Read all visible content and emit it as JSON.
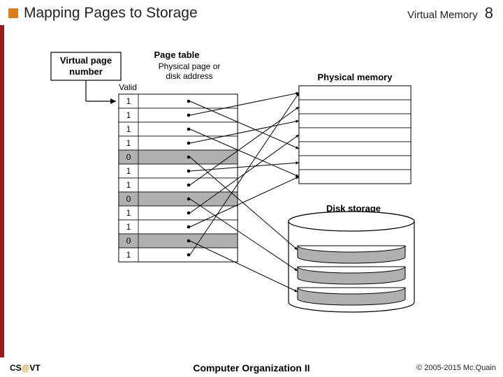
{
  "header": {
    "title": "Mapping Pages to Storage",
    "section": "Virtual Memory",
    "page_num": "8"
  },
  "diagram": {
    "vpn_box": [
      "Virtual page",
      "number"
    ],
    "pagetable_title": "Page table",
    "pagetable_sub": [
      "Physical page or",
      "disk address"
    ],
    "valid_label": "Valid",
    "physmem_label": "Physical memory",
    "disk_label": "Disk storage",
    "valid_bits": [
      "1",
      "1",
      "1",
      "1",
      "0",
      "1",
      "1",
      "0",
      "1",
      "1",
      "0",
      "1"
    ]
  },
  "footer": {
    "left_a": "CS",
    "left_at": "@",
    "left_b": "VT",
    "center": "Computer Organization II",
    "right": "© 2005-2015 Mc.Quain"
  }
}
